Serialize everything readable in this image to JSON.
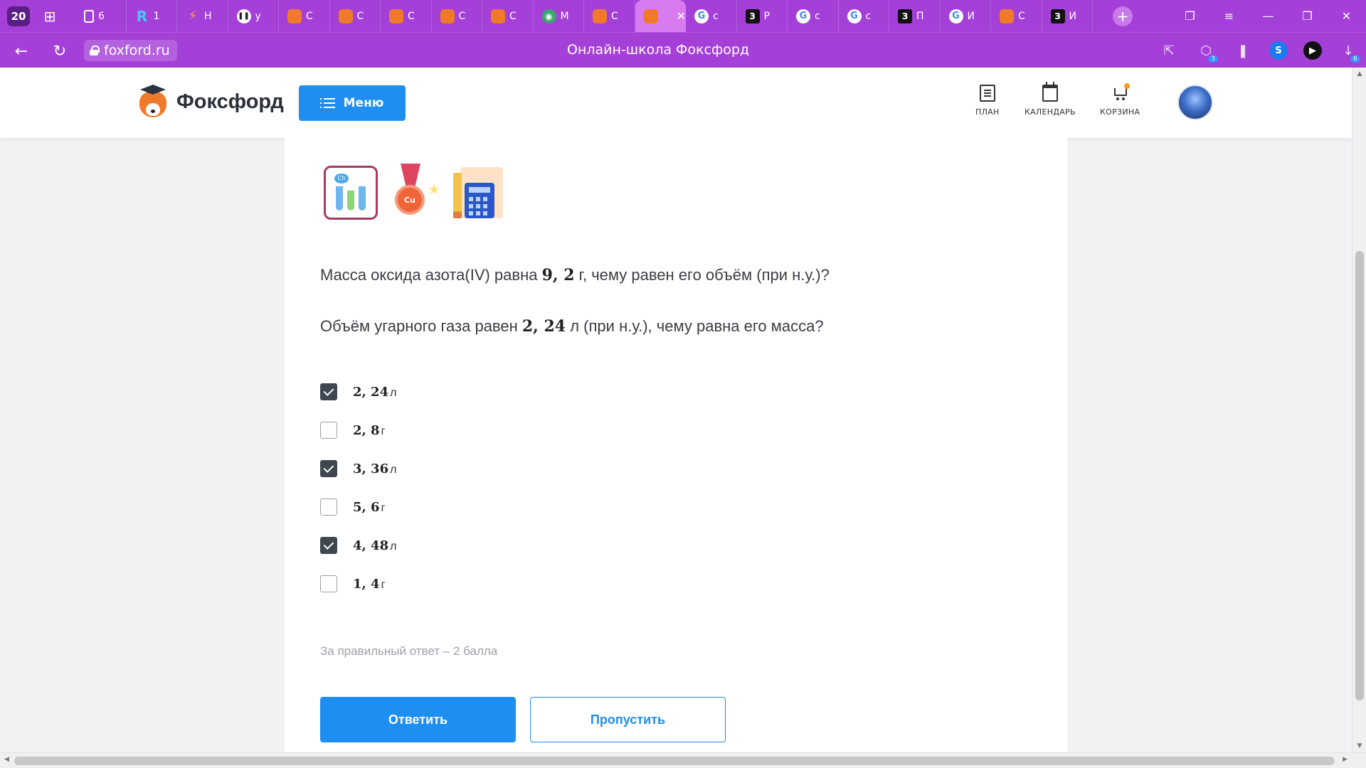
{
  "browser": {
    "tab_count": "20",
    "tabs": [
      {
        "icon": "doc-icon",
        "label": "6"
      },
      {
        "icon": "r-icon",
        "label": "1"
      },
      {
        "icon": "bolt-icon",
        "label": "H"
      },
      {
        "icon": "pause-icon",
        "label": "у"
      },
      {
        "icon": "fox-icon",
        "label": "С"
      },
      {
        "icon": "fox-icon",
        "label": "С"
      },
      {
        "icon": "fox-icon",
        "label": "С"
      },
      {
        "icon": "fox-icon",
        "label": "С"
      },
      {
        "icon": "fox-icon",
        "label": "С"
      },
      {
        "icon": "globe-icon",
        "label": "М"
      },
      {
        "icon": "fox-icon",
        "label": "С"
      },
      {
        "icon": "fox-icon",
        "label": "",
        "active": true
      },
      {
        "icon": "google-icon",
        "label": "с"
      },
      {
        "icon": "zen-icon",
        "label": "Р"
      },
      {
        "icon": "google-icon",
        "label": "с"
      },
      {
        "icon": "google-icon",
        "label": "с"
      },
      {
        "icon": "zen-icon",
        "label": "П"
      },
      {
        "icon": "google-icon",
        "label": "И"
      },
      {
        "icon": "fox-icon",
        "label": "С"
      },
      {
        "icon": "zen-icon",
        "label": "И"
      }
    ],
    "url": "foxford.ru",
    "page_title": "Онлайн-школа Фоксфорд",
    "extensions_badge": "3",
    "downloads_badge": "6"
  },
  "header": {
    "logo_text": "Фоксфорд",
    "menu_label": "Меню",
    "nav": [
      {
        "label": "ПЛАН",
        "icon": "plan-icon"
      },
      {
        "label": "КАЛЕНДАРЬ",
        "icon": "calendar-icon"
      },
      {
        "label": "КОРЗИНА",
        "icon": "cart-icon"
      }
    ]
  },
  "task": {
    "q1_pre": "Масса оксида азота(IV) равна ",
    "q1_num": "9, 2",
    "q1_post": " г, чему равен его объём (при н.у.)?",
    "q2_pre": "Объём угарного газа равен ",
    "q2_num": "2, 24",
    "q2_post": " л (при н.у.), чему равна его масса?",
    "options": [
      {
        "num": "2, 24",
        "unit": "л",
        "checked": true
      },
      {
        "num": "2, 8",
        "unit": "г",
        "checked": false
      },
      {
        "num": "3, 36",
        "unit": "л",
        "checked": true
      },
      {
        "num": "5, 6",
        "unit": "г",
        "checked": false
      },
      {
        "num": "4, 48",
        "unit": "л",
        "checked": true
      },
      {
        "num": "1, 4",
        "unit": "г",
        "checked": false
      }
    ],
    "points_note": "За правильный ответ – 2 балла",
    "answer_label": "Ответить",
    "skip_label": "Пропустить",
    "chem_badge_text": "Ch",
    "medal_text": "Cu"
  },
  "colors": {
    "browser_accent": "#a43fd8",
    "primary_button": "#1f8ef1"
  }
}
